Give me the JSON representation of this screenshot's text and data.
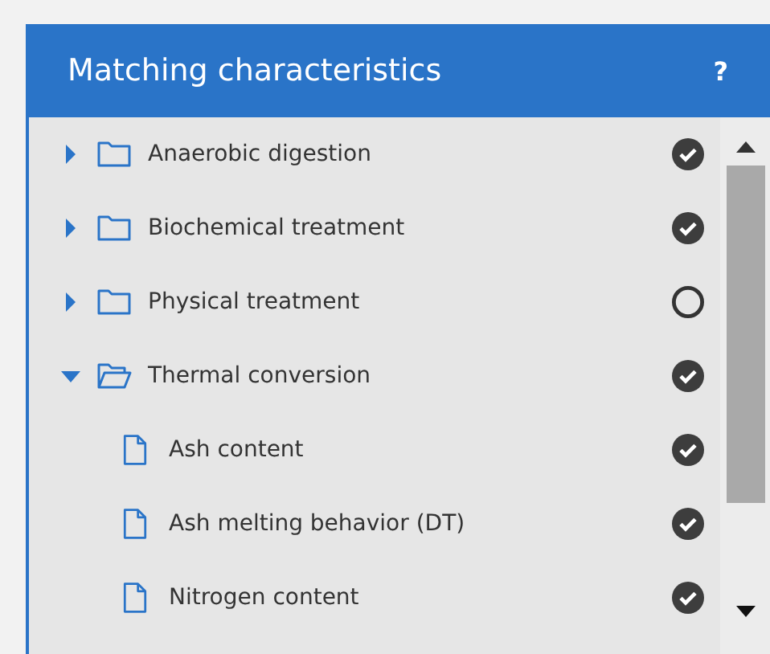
{
  "panel": {
    "title": "Matching characteristics",
    "help": "?"
  },
  "tree": [
    {
      "label": "Anaerobic digestion",
      "kind": "folder",
      "expanded": false,
      "matched": true
    },
    {
      "label": "Biochemical treatment",
      "kind": "folder",
      "expanded": false,
      "matched": true
    },
    {
      "label": "Physical treatment",
      "kind": "folder",
      "expanded": false,
      "matched": false
    },
    {
      "label": "Thermal conversion",
      "kind": "folder",
      "expanded": true,
      "matched": true,
      "children": [
        {
          "label": "Ash content",
          "kind": "file",
          "matched": true
        },
        {
          "label": "Ash melting behavior (DT)",
          "kind": "file",
          "matched": true
        },
        {
          "label": "Nitrogen content",
          "kind": "file",
          "matched": true
        }
      ]
    }
  ]
}
